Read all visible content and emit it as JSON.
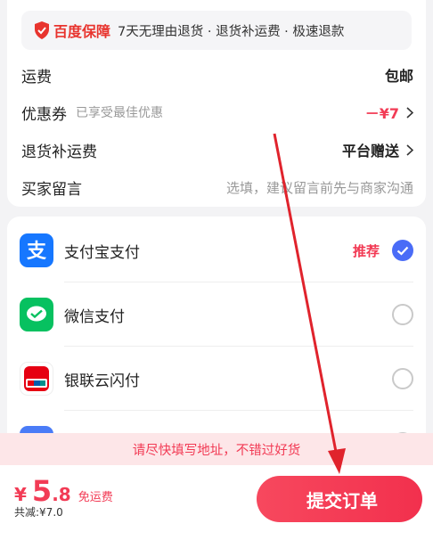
{
  "guarantee": {
    "brand": "百度保障",
    "text": "7天无理由退货 · 退货补运费 · 极速退款"
  },
  "order_rows": {
    "shipping": {
      "label": "运费",
      "value": "包邮"
    },
    "coupon": {
      "label": "优惠券",
      "hint": "已享受最佳优惠",
      "value": "－¥7"
    },
    "return_shipping": {
      "label": "退货补运费",
      "value": "平台赠送"
    },
    "buyer_note": {
      "label": "买家留言",
      "placeholder": "选填，建议留言前先与商家沟通"
    }
  },
  "payment_methods": [
    {
      "name": "支付宝支付",
      "badge": "推荐",
      "selected": true,
      "icon": "alipay-icon"
    },
    {
      "name": "微信支付",
      "selected": false,
      "icon": "wechat-pay-icon"
    },
    {
      "name": "银联云闪付",
      "selected": false,
      "icon": "unionpay-icon"
    }
  ],
  "banner": {
    "text": "请尽快填写地址，不错过好货"
  },
  "bottom": {
    "currency": "¥",
    "price_int": "5",
    "price_dec": ".8",
    "free_shipping": "免运费",
    "saved": "共减:¥7.0",
    "submit_label": "提交订单"
  },
  "colors": {
    "accent": "#f23b55",
    "selected": "#4a6cf7",
    "brand_red": "#e8342e",
    "arrow": "#e0232c"
  }
}
